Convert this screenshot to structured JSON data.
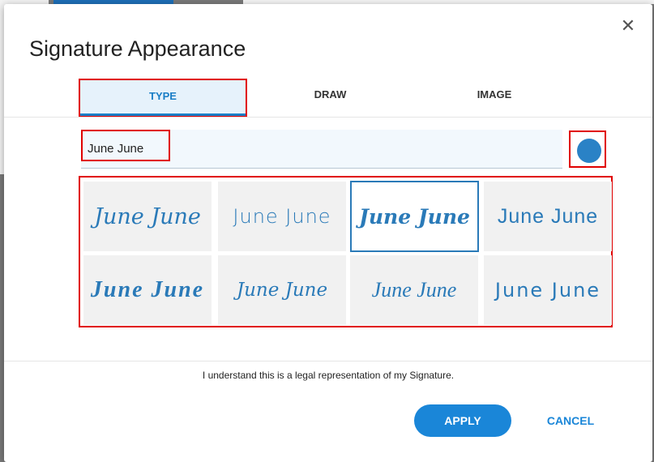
{
  "dialog": {
    "title": "Signature Appearance",
    "close_icon": "close-icon"
  },
  "tabs": [
    {
      "label": "TYPE",
      "active": true
    },
    {
      "label": "DRAW",
      "active": false
    },
    {
      "label": "IMAGE",
      "active": false
    }
  ],
  "name_input": {
    "value": "June June"
  },
  "color_picker": {
    "color": "#2a82c6"
  },
  "signatures": [
    {
      "text": "June June",
      "selected": false
    },
    {
      "text": "June June",
      "selected": false
    },
    {
      "text": "June June",
      "selected": true
    },
    {
      "text": "June June",
      "selected": false
    },
    {
      "text": "June June",
      "selected": false
    },
    {
      "text": "June June",
      "selected": false
    },
    {
      "text": "June June",
      "selected": false
    },
    {
      "text": "June June",
      "selected": false
    }
  ],
  "legal_text": "I understand this is a legal representation of my Signature.",
  "buttons": {
    "apply": "APPLY",
    "cancel": "CANCEL"
  },
  "colors": {
    "accent": "#1a86d8",
    "signature": "#2a7ab8",
    "highlight": "#e00000"
  }
}
